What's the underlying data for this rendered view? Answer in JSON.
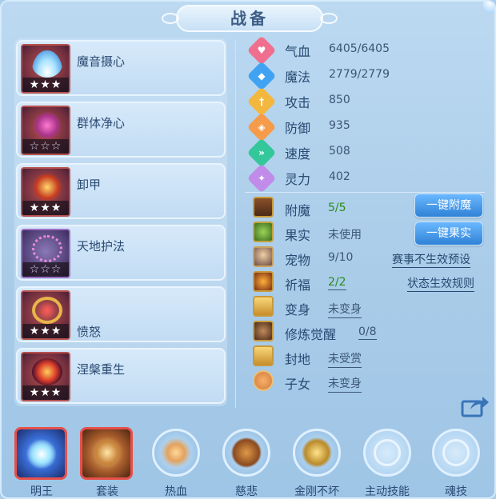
{
  "title": "战备",
  "skills": [
    {
      "name": "魔音摄心",
      "stars": "★★★",
      "hollow": false
    },
    {
      "name": "群体净心",
      "stars": "☆☆☆",
      "hollow": true
    },
    {
      "name": "卸甲",
      "stars": "★★★",
      "hollow": false
    },
    {
      "name": "天地护法",
      "stars": "☆☆☆",
      "hollow": true
    },
    {
      "name": "愤怒",
      "stars": "★★★",
      "hollow": false
    },
    {
      "name": "涅槃重生",
      "stars": "★★★",
      "hollow": false
    }
  ],
  "stats": [
    {
      "label": "气血",
      "value": "6405/6405",
      "icon": "heart-icon",
      "color": "#f06f8f"
    },
    {
      "label": "魔法",
      "value": "2779/2779",
      "icon": "mana-icon",
      "color": "#3fa3f2"
    },
    {
      "label": "攻击",
      "value": "850",
      "icon": "sword-icon",
      "color": "#f2b73c"
    },
    {
      "label": "防御",
      "value": "935",
      "icon": "shield-icon",
      "color": "#f59b4a"
    },
    {
      "label": "速度",
      "value": "508",
      "icon": "speed-icon",
      "color": "#33c79a"
    },
    {
      "label": "灵力",
      "value": "402",
      "icon": "spirit-icon",
      "color": "#c08be9"
    }
  ],
  "extras": {
    "enchant": {
      "label": "附魔",
      "value": "5/5"
    },
    "fruit": {
      "label": "果实",
      "value": "未使用"
    },
    "pet": {
      "label": "宠物",
      "value": "9/10"
    },
    "blessing": {
      "label": "祈福",
      "value": "2/2"
    },
    "transform": {
      "label": "变身",
      "value": "未变身"
    },
    "awaken": {
      "label": "修炼觉醒",
      "value": "0/8"
    },
    "fief": {
      "label": "封地",
      "value": "未受赏"
    },
    "child": {
      "label": "子女",
      "value": "未变身"
    }
  },
  "buttons": {
    "one_click_enchant": "一键附魔",
    "one_click_fruit": "一键果实",
    "event_preset": "赛事不生效预设",
    "status_rules": "状态生效规则"
  },
  "tabs": [
    {
      "label": "明王",
      "underline": true
    },
    {
      "label": "套装",
      "underline": true
    },
    {
      "label": "热血",
      "underline": false
    },
    {
      "label": "慈悲",
      "underline": false
    },
    {
      "label": "金刚不坏",
      "underline": false
    },
    {
      "label": "主动技能",
      "underline": false
    },
    {
      "label": "魂技",
      "underline": false
    }
  ]
}
